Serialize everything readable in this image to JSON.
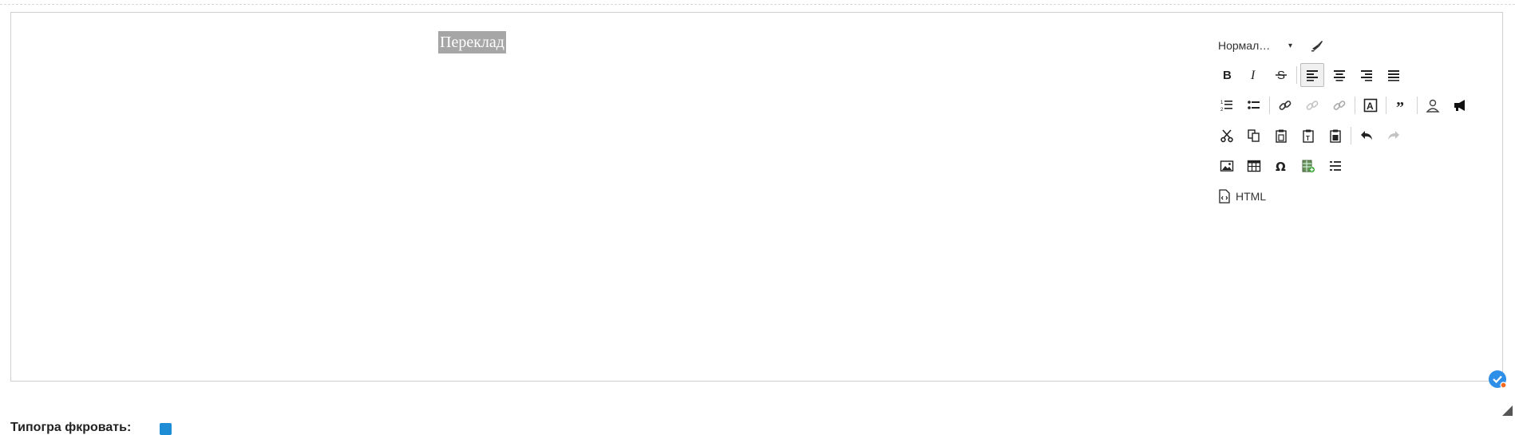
{
  "editor": {
    "selected_text": "Переклад",
    "format_combo": {
      "label": "Нормал…",
      "arrow": "▾"
    },
    "html_button": {
      "label": "HTML"
    },
    "toolbar": {
      "row1": [
        "bold-icon",
        "italic-icon",
        "strikethrough-icon",
        "align-left-icon",
        "align-center-icon",
        "align-right-icon",
        "align-justify-icon"
      ],
      "row2": [
        "numbered-list-icon",
        "bulleted-list-icon",
        "link-icon",
        "unlink-icon",
        "anchor-icon",
        "text-box-icon",
        "blockquote-icon",
        "user-icon",
        "megaphone-icon"
      ],
      "row3": [
        "cut-icon",
        "copy-icon",
        "paste-icon",
        "paste-text-icon",
        "paste-word-icon",
        "undo-icon",
        "redo-icon"
      ],
      "row4": [
        "image-icon",
        "table-icon",
        "special-char-icon",
        "spreadsheet-icon",
        "horizontal-rule-icon"
      ]
    },
    "active_alignment": "left"
  },
  "bottom": {
    "label": "Типогра фкровать:",
    "checked": true
  },
  "colors": {
    "accent": "#1f8dd6",
    "selection_bg": "#a6a6a6",
    "border": "#cfcfcf"
  }
}
